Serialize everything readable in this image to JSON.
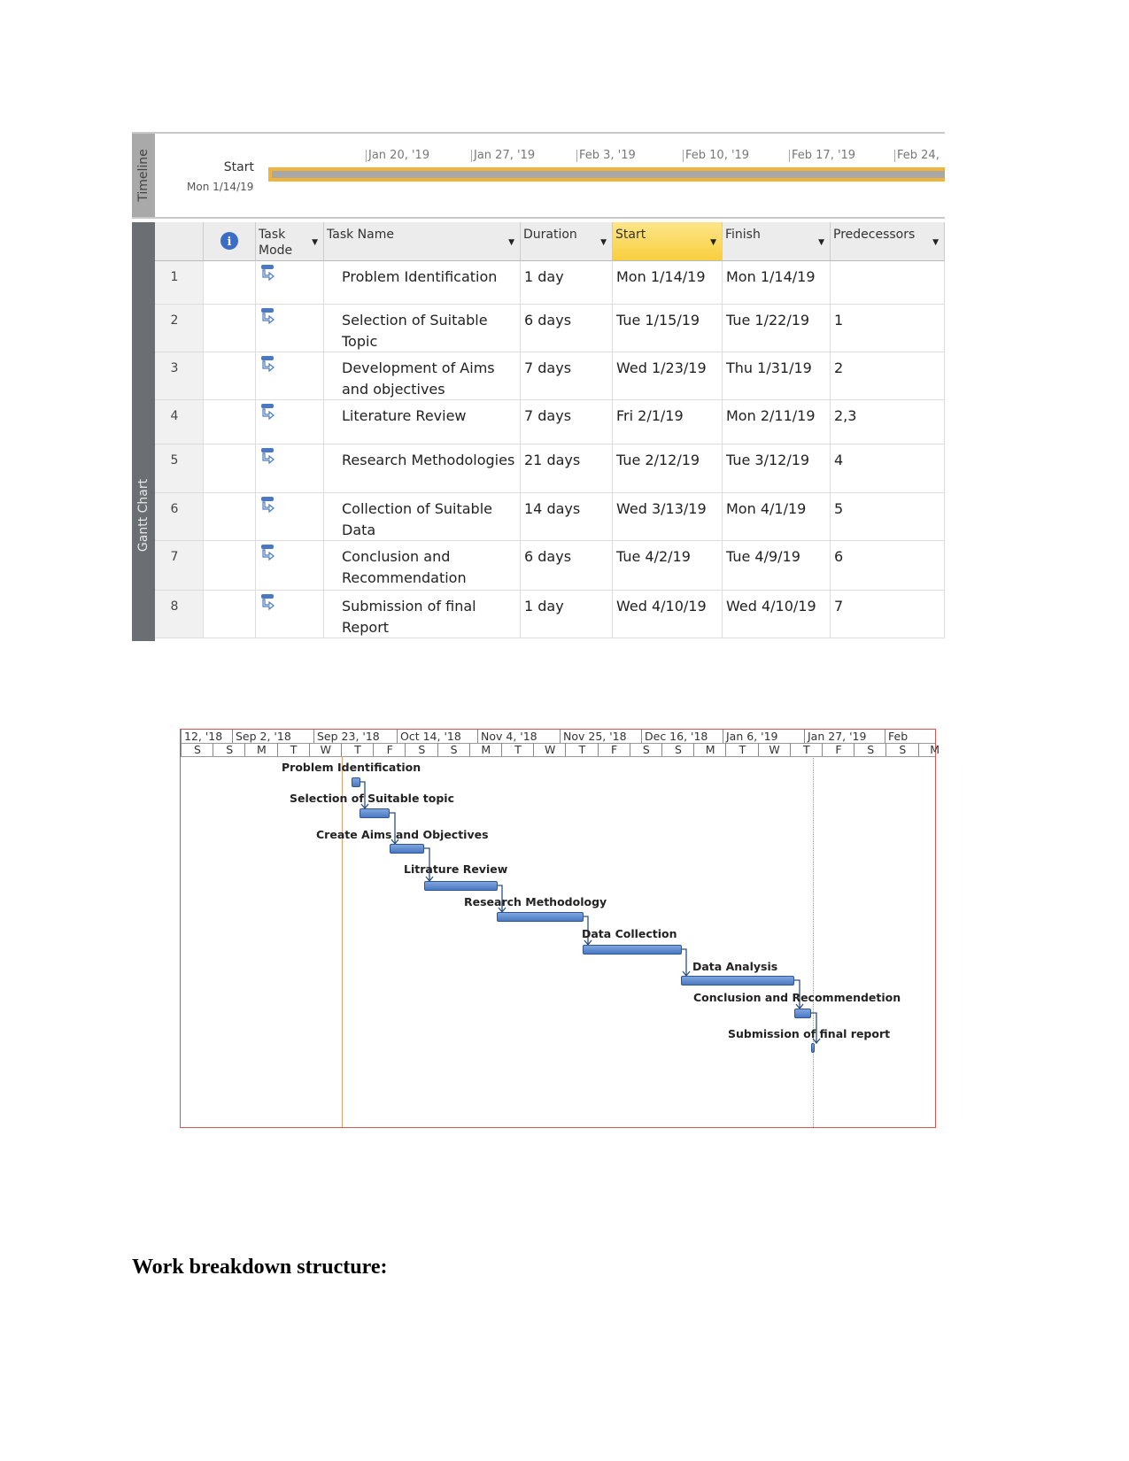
{
  "timeline": {
    "tab_label": "Timeline",
    "start_label": "Start",
    "start_date": "Mon 1/14/19",
    "scale": [
      "Jan 20, '19",
      "Jan 27, '19",
      "Feb 3, '19",
      "Feb 10, '19",
      "Feb 17, '19",
      "Feb 24,"
    ],
    "bar_color": "#f0b43a"
  },
  "table": {
    "side_tab": "Gantt Chart",
    "info_icon": "info-icon",
    "columns": {
      "mode": "Task Mode",
      "name": "Task Name",
      "duration": "Duration",
      "start": "Start",
      "finish": "Finish",
      "predecessors": "Predecessors"
    },
    "rows": [
      {
        "id": "1",
        "name": "Problem Identification",
        "duration": "1 day",
        "start": "Mon 1/14/19",
        "finish": "Mon 1/14/19",
        "pred": ""
      },
      {
        "id": "2",
        "name": "Selection of Suitable Topic",
        "duration": "6 days",
        "start": "Tue 1/15/19",
        "finish": "Tue 1/22/19",
        "pred": "1"
      },
      {
        "id": "3",
        "name": "Development of Aims and objectives",
        "duration": "7 days",
        "start": "Wed 1/23/19",
        "finish": "Thu 1/31/19",
        "pred": "2"
      },
      {
        "id": "4",
        "name": "Literature Review",
        "duration": "7 days",
        "start": "Fri 2/1/19",
        "finish": "Mon 2/11/19",
        "pred": "2,3"
      },
      {
        "id": "5",
        "name": "Research Methodologies",
        "duration": "21 days",
        "start": "Tue 2/12/19",
        "finish": "Tue 3/12/19",
        "pred": "4"
      },
      {
        "id": "6",
        "name": "Collection of Suitable Data",
        "duration": "14 days",
        "start": "Wed 3/13/19",
        "finish": "Mon 4/1/19",
        "pred": "5"
      },
      {
        "id": "7",
        "name": "Conclusion and Recommendation",
        "duration": "6 days",
        "start": "Tue 4/2/19",
        "finish": "Tue 4/9/19",
        "pred": "6"
      },
      {
        "id": "8",
        "name": "Submission of final Report",
        "duration": "1 day",
        "start": "Wed 4/10/19",
        "finish": "Wed 4/10/19",
        "pred": "7"
      }
    ]
  },
  "gantt": {
    "weeks": [
      "12, '18",
      "Sep 2, '18",
      "Sep 23, '18",
      "Oct 14, '18",
      "Nov 4, '18",
      "Nov 25, '18",
      "Dec 16, '18",
      "Jan 6, '19",
      "Jan 27, '19",
      "Feb"
    ],
    "days": [
      "S",
      "S",
      "M",
      "T",
      "W",
      "T",
      "F",
      "S",
      "S",
      "M",
      "T",
      "W",
      "T",
      "F",
      "S",
      "S",
      "M",
      "T",
      "W",
      "T",
      "F",
      "S",
      "S",
      "M"
    ],
    "tasks": [
      "Problem Identification",
      "Selection of Suitable topic",
      "Create Aims and Objectives",
      "Litrature Review",
      "Research Methodology",
      "Data Collection",
      "Data Analysis",
      "Conclusion and Recommendetion",
      "Submission of final report"
    ],
    "bar_color": "#4a79c2",
    "border_color": "#d9534f"
  },
  "heading": "Work breakdown structure:"
}
